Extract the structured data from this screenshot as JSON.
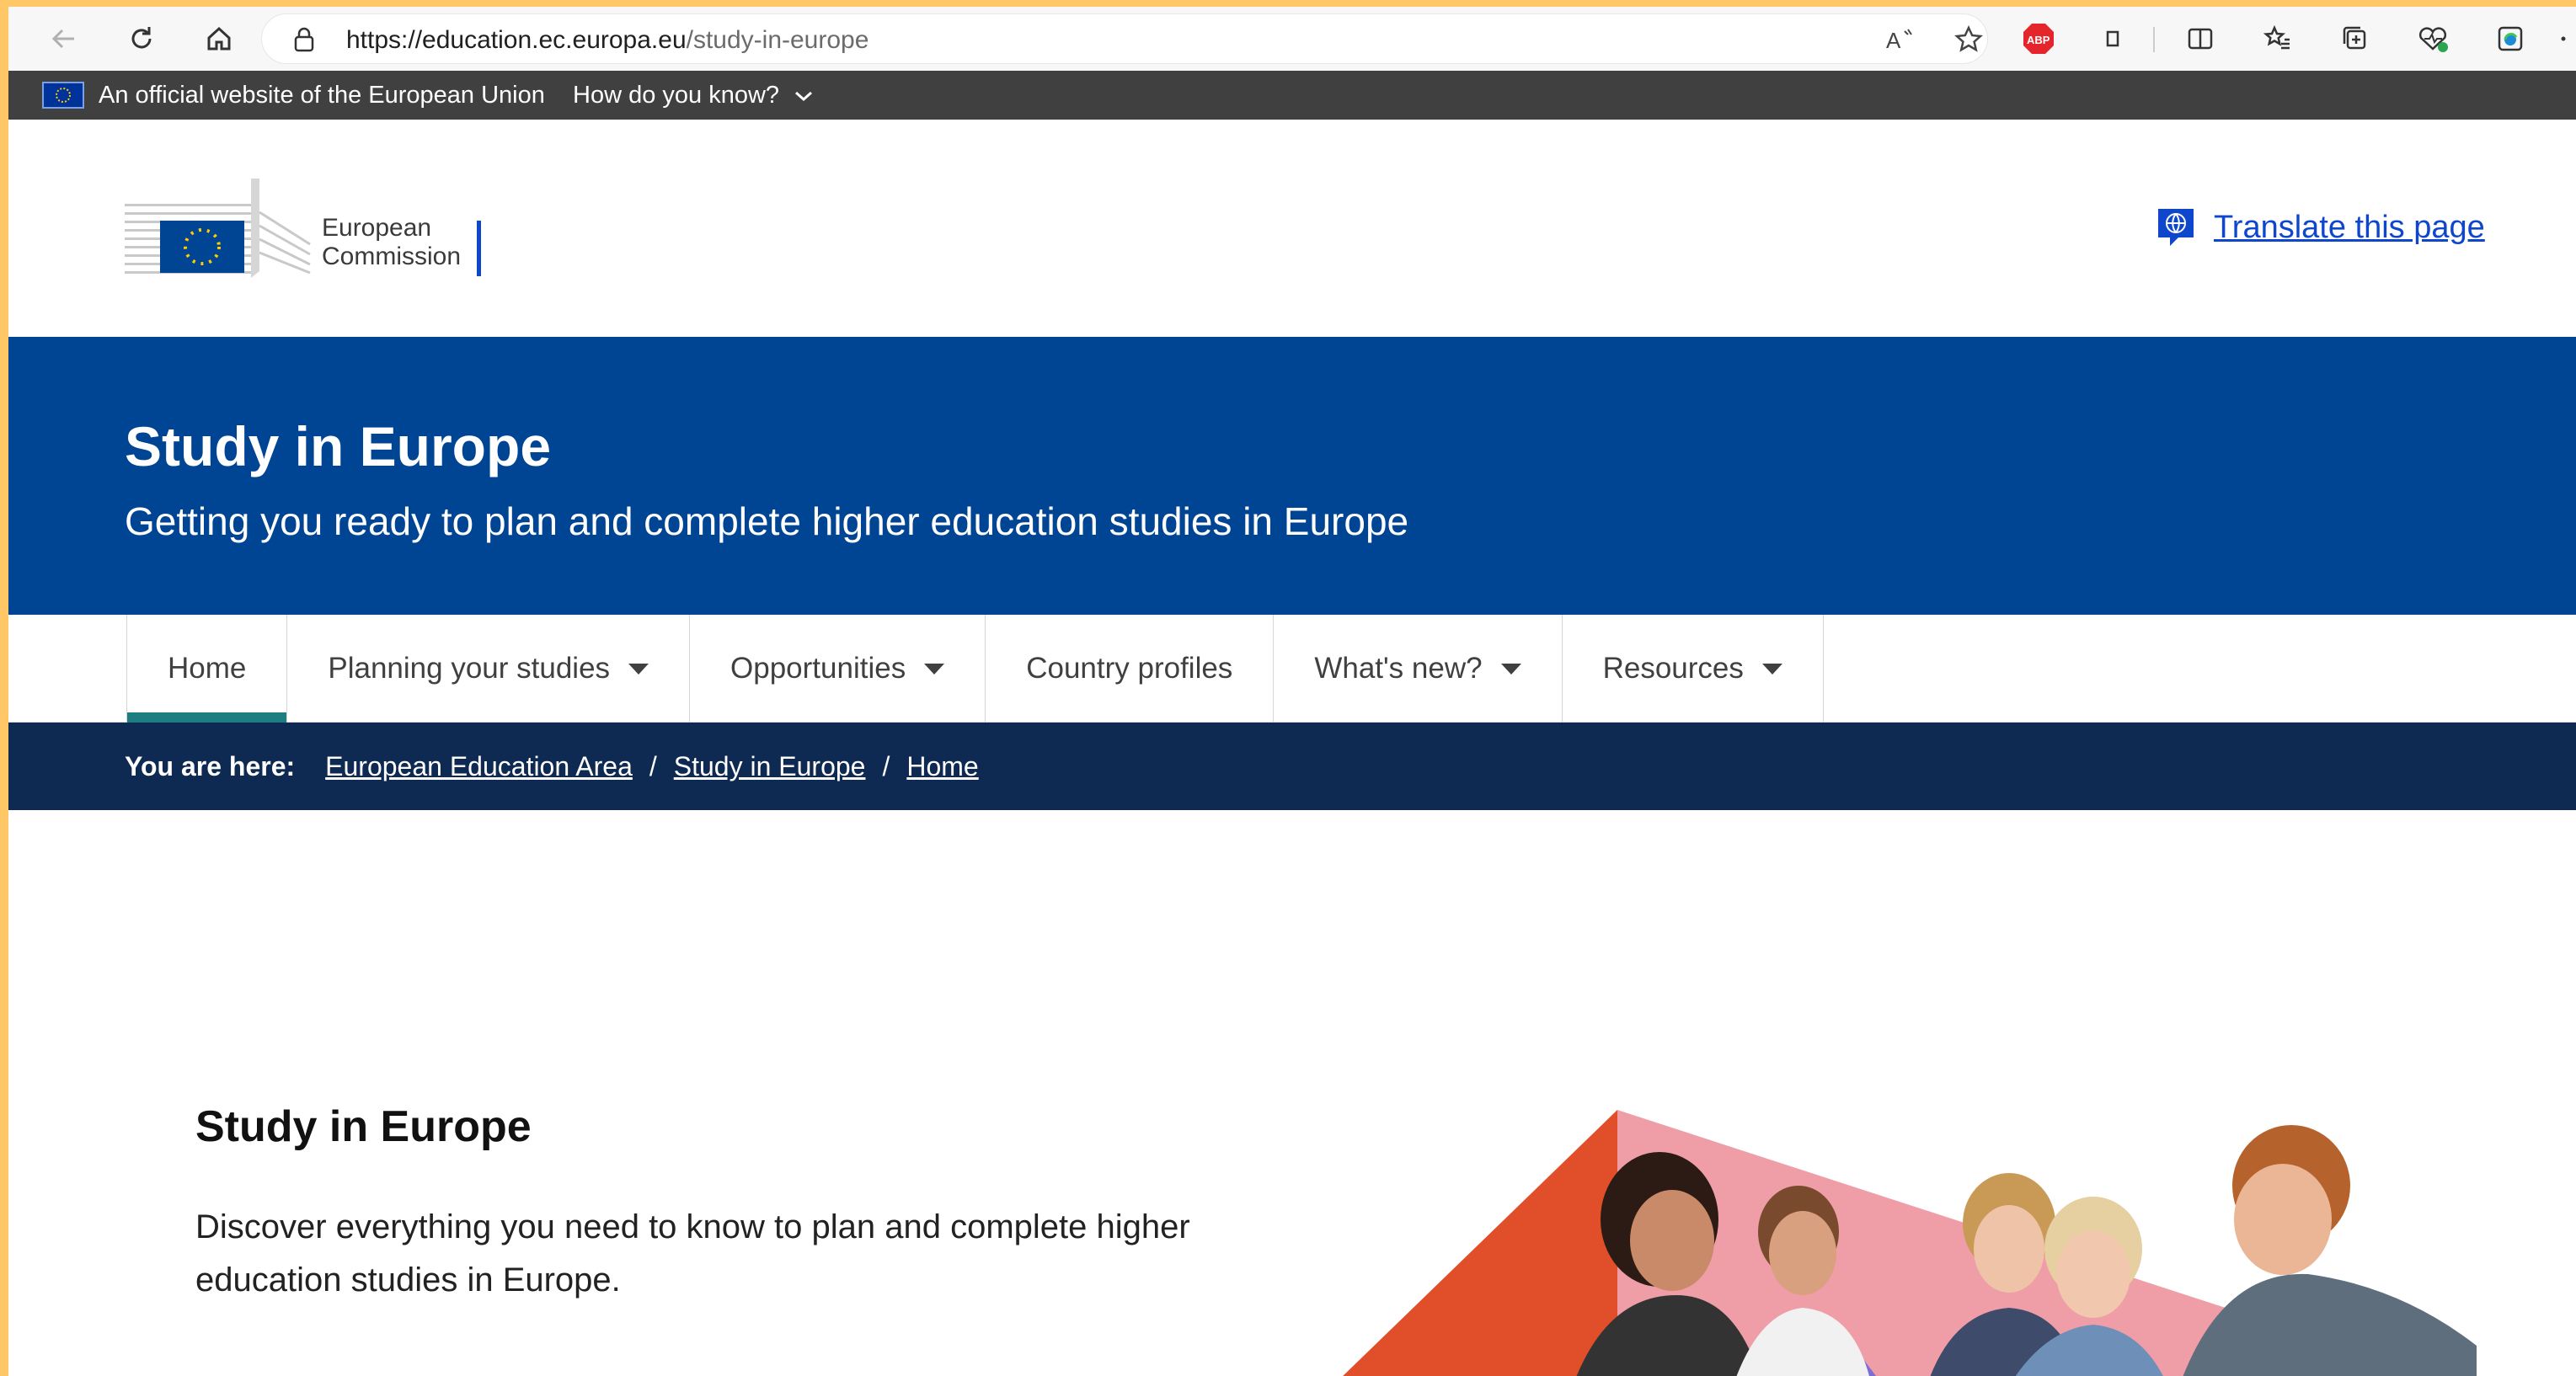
{
  "browser": {
    "url_host": "https://education.ec.europa.eu",
    "url_path": "/study-in-europe"
  },
  "eu_bar": {
    "official_text": "An official website of the European Union",
    "how_know": "How do you know?"
  },
  "header": {
    "logo_line1": "European",
    "logo_line2": "Commission",
    "translate_label": "Translate this page"
  },
  "banner": {
    "title": "Study in Europe",
    "subtitle": "Getting you ready to plan and complete higher education studies in Europe"
  },
  "nav": {
    "items": [
      {
        "label": "Home",
        "dropdown": false,
        "active": true
      },
      {
        "label": "Planning your studies",
        "dropdown": true
      },
      {
        "label": "Opportunities",
        "dropdown": true
      },
      {
        "label": "Country profiles",
        "dropdown": false
      },
      {
        "label": "What's new?",
        "dropdown": true
      },
      {
        "label": "Resources",
        "dropdown": true
      }
    ]
  },
  "breadcrumb": {
    "label": "You are here:",
    "items": [
      "European Education Area",
      "Study in Europe",
      "Home"
    ]
  },
  "content": {
    "title": "Study in Europe",
    "text": "Discover everything you need to know to plan and complete higher education studies in Europe."
  },
  "colors": {
    "banner_blue": "#004494",
    "breadcrumb_navy": "#0e2952",
    "link_blue": "#0e47cb",
    "active_teal": "#1d7d80"
  }
}
